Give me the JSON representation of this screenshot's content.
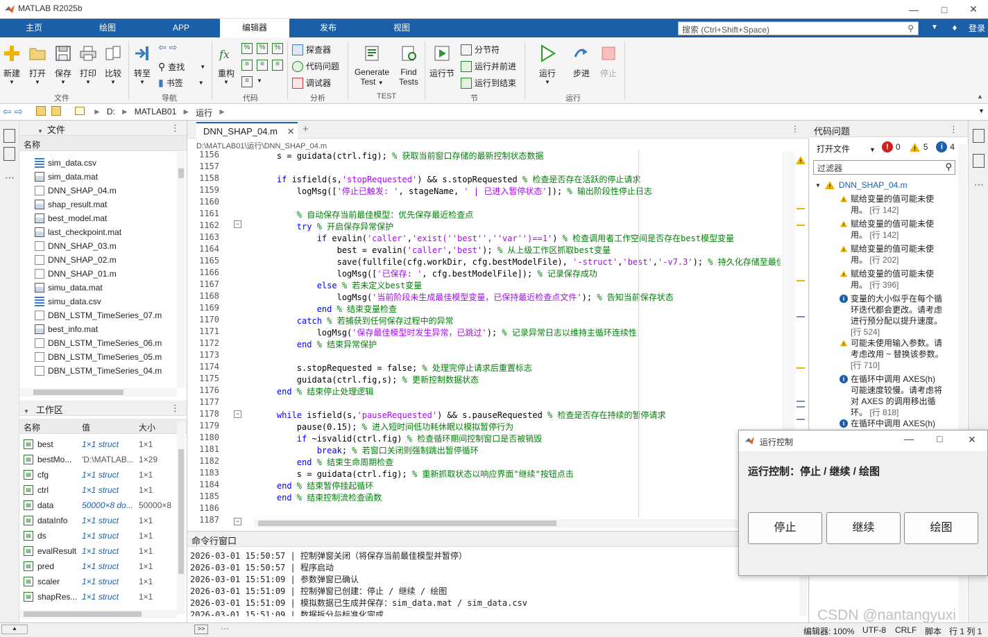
{
  "window": {
    "title": "MATLAB R2025b"
  },
  "tabs": [
    {
      "label": "主页"
    },
    {
      "label": "绘图"
    },
    {
      "label": "APP"
    },
    {
      "label": "编辑器"
    },
    {
      "label": "发布"
    },
    {
      "label": "视图"
    }
  ],
  "search": {
    "placeholder": "搜索 (Ctrl+Shift+Space)"
  },
  "login": "登录",
  "ribbon": {
    "file": {
      "group": "文件",
      "new": "新建",
      "open": "打开",
      "save": "保存",
      "print": "打印",
      "compare": "比较"
    },
    "nav": {
      "group": "导航",
      "goto": "转至",
      "find": "查找",
      "bookmark": "书签"
    },
    "code": {
      "group": "代码",
      "refactor": "重构"
    },
    "analyze": {
      "group": "分析",
      "explorer": "探查器",
      "issues": "代码问题",
      "debugger": "调试器"
    },
    "test": {
      "group": "TEST",
      "gen1": "Generate",
      "gen2": "Test",
      "find1": "Find",
      "find2": "Tests"
    },
    "section": {
      "group": "节",
      "run_section": "运行节",
      "divider": "分节符",
      "run_advance": "运行并前进",
      "run_to_end": "运行到结束"
    },
    "run": {
      "group": "运行",
      "run": "运行",
      "step": "步进",
      "stop": "停止"
    }
  },
  "address": {
    "parts": [
      "D:",
      "MATLAB01",
      "运行"
    ]
  },
  "files": {
    "title": "文件",
    "col_name": "名称",
    "items": [
      "sim_data.csv",
      "sim_data.mat",
      "DNN_SHAP_04.m",
      "shap_result.mat",
      "best_model.mat",
      "last_checkpoint.mat",
      "DNN_SHAP_03.m",
      "DNN_SHAP_02.m",
      "DNN_SHAP_01.m",
      "simu_data.mat",
      "simu_data.csv",
      "DBN_LSTM_TimeSeries_07.m",
      "best_info.mat",
      "DBN_LSTM_TimeSeries_06.m",
      "DBN_LSTM_TimeSeries_05.m",
      "DBN_LSTM_TimeSeries_04.m",
      "DBN_LSTM_TimeSeries_03.m"
    ]
  },
  "workspace": {
    "title": "工作区",
    "cols": {
      "name": "名称",
      "value": "值",
      "size": "大小"
    },
    "rows": [
      {
        "name": "best",
        "value": "1×1 struct",
        "size": "1×1"
      },
      {
        "name": "bestMo...",
        "value": "'D:\\MATLAB...",
        "size": "1×29"
      },
      {
        "name": "cfg",
        "value": "1×1 struct",
        "size": "1×1"
      },
      {
        "name": "ctrl",
        "value": "1×1 struct",
        "size": "1×1"
      },
      {
        "name": "data",
        "value": "50000×8 do...",
        "size": "50000×8"
      },
      {
        "name": "dataInfo",
        "value": "1×1 struct",
        "size": "1×1"
      },
      {
        "name": "ds",
        "value": "1×1 struct",
        "size": "1×1"
      },
      {
        "name": "evalResult",
        "value": "1×1 struct",
        "size": "1×1"
      },
      {
        "name": "pred",
        "value": "1×1 struct",
        "size": "1×1"
      },
      {
        "name": "scaler",
        "value": "1×1 struct",
        "size": "1×1"
      },
      {
        "name": "shapRes...",
        "value": "1×1 struct",
        "size": "1×1"
      }
    ]
  },
  "editor": {
    "tab": "DNN_SHAP_04.m",
    "path": "D:\\MATLAB01\\运行\\DNN_SHAP_04.m",
    "lines": [
      {
        "n": "1156",
        "segs": [
          [
            "",
            "    s = guidata(ctrl.fig); "
          ],
          [
            "cm",
            "% 获取当前窗口存储的最新控制状态数据"
          ]
        ]
      },
      {
        "n": "1157",
        "segs": []
      },
      {
        "n": "1158",
        "segs": [
          [
            "kw",
            "    if "
          ],
          [
            "",
            "isfield(s,"
          ],
          [
            "str",
            "'stopRequested'"
          ],
          [
            "",
            ") && s.stopRequested "
          ],
          [
            "cm",
            "% 检查是否存在活跃的停止请求"
          ]
        ]
      },
      {
        "n": "1159",
        "segs": [
          [
            "",
            "        logMsg(["
          ],
          [
            "str",
            "'停止已触发: '"
          ],
          [
            "",
            ", stageName, "
          ],
          [
            "str",
            "' | 已进入暂停状态'"
          ],
          [
            "",
            "]); "
          ],
          [
            "cm",
            "% 输出阶段性停止日志"
          ]
        ]
      },
      {
        "n": "1160",
        "segs": []
      },
      {
        "n": "1161",
        "segs": [
          [
            "cm",
            "        % 自动保存当前最佳模型：优先保存最近检查点"
          ]
        ]
      },
      {
        "n": "1162",
        "segs": [
          [
            "kw",
            "        try "
          ],
          [
            "cm",
            "% 开启保存异常保护"
          ]
        ]
      },
      {
        "n": "1163",
        "segs": [
          [
            "kw",
            "            if "
          ],
          [
            "",
            "evalin("
          ],
          [
            "str",
            "'caller'"
          ],
          [
            "",
            ","
          ],
          [
            "str",
            "'exist(''best'',''var'')==1'"
          ],
          [
            "",
            ") "
          ],
          [
            "cm",
            "% 检查调用者工作空间是否存在best模型变量"
          ]
        ]
      },
      {
        "n": "1164",
        "segs": [
          [
            "",
            "                best = evalin("
          ],
          [
            "str",
            "'caller'"
          ],
          [
            "",
            ","
          ],
          [
            "str",
            "'best'"
          ],
          [
            "",
            "); "
          ],
          [
            "cm",
            "% 从上级工作区抓取best变量"
          ]
        ]
      },
      {
        "n": "1165",
        "segs": [
          [
            "",
            "                save(fullfile(cfg.workDir, cfg.bestModelFile), "
          ],
          [
            "str",
            "'-struct'"
          ],
          [
            "",
            ","
          ],
          [
            "str",
            "'best'"
          ],
          [
            "",
            ","
          ],
          [
            "str",
            "'-v7.3'"
          ],
          [
            "",
            "); "
          ],
          [
            "cm",
            "% 持久化存储至最佳"
          ]
        ]
      },
      {
        "n": "1166",
        "segs": [
          [
            "",
            "                logMsg(["
          ],
          [
            "str",
            "'已保存: '"
          ],
          [
            "",
            ", cfg.bestModelFile]); "
          ],
          [
            "cm",
            "% 记录保存成功"
          ]
        ]
      },
      {
        "n": "1167",
        "segs": [
          [
            "kw",
            "            else "
          ],
          [
            "cm",
            "% 若未定义best变量"
          ]
        ]
      },
      {
        "n": "1168",
        "segs": [
          [
            "",
            "                logMsg("
          ],
          [
            "str",
            "'当前阶段未生成最佳模型变量，已保持最近检查点文件'"
          ],
          [
            "",
            "); "
          ],
          [
            "cm",
            "% 告知当前保存状态"
          ]
        ]
      },
      {
        "n": "1169",
        "segs": [
          [
            "kw",
            "            end "
          ],
          [
            "cm",
            "% 结束变量检查"
          ]
        ]
      },
      {
        "n": "1170",
        "segs": [
          [
            "kw",
            "        catch "
          ],
          [
            "cm",
            "% 若捕获到任何保存过程中的异常"
          ]
        ]
      },
      {
        "n": "1171",
        "segs": [
          [
            "",
            "            logMsg("
          ],
          [
            "str",
            "'保存最佳模型时发生异常，已跳过'"
          ],
          [
            "",
            "); "
          ],
          [
            "cm",
            "% 记录异常日志以维持主循环连续性"
          ]
        ]
      },
      {
        "n": "1172",
        "segs": [
          [
            "kw",
            "        end "
          ],
          [
            "cm",
            "% 结束异常保护"
          ]
        ]
      },
      {
        "n": "1173",
        "segs": []
      },
      {
        "n": "1174",
        "segs": [
          [
            "",
            "        s.stopRequested = false; "
          ],
          [
            "cm",
            "% 处理完停止请求后重置标志"
          ]
        ]
      },
      {
        "n": "1175",
        "segs": [
          [
            "",
            "        guidata(ctrl.fig,s); "
          ],
          [
            "cm",
            "% 更新控制数据状态"
          ]
        ]
      },
      {
        "n": "1176",
        "segs": [
          [
            "kw",
            "    end "
          ],
          [
            "cm",
            "% 结束停止处理逻辑"
          ]
        ]
      },
      {
        "n": "1177",
        "segs": []
      },
      {
        "n": "1178",
        "segs": [
          [
            "kw",
            "    while "
          ],
          [
            "",
            "isfield(s,"
          ],
          [
            "str",
            "'pauseRequested'"
          ],
          [
            "",
            ") && s.pauseRequested "
          ],
          [
            "cm",
            "% 检查是否存在持续的暂停请求"
          ]
        ]
      },
      {
        "n": "1179",
        "segs": [
          [
            "",
            "        pause(0.15); "
          ],
          [
            "cm",
            "% 进入短时间低功耗休眠以模拟暂停行为"
          ]
        ]
      },
      {
        "n": "1180",
        "segs": [
          [
            "kw",
            "        if "
          ],
          [
            "",
            "~isvalid(ctrl.fig) "
          ],
          [
            "cm",
            "% 检查循环期间控制窗口是否被销毁"
          ]
        ]
      },
      {
        "n": "1181",
        "segs": [
          [
            "kw",
            "            break"
          ],
          [
            "",
            "; "
          ],
          [
            "cm",
            "% 若窗口关闭则强制跳出暂停循环"
          ]
        ]
      },
      {
        "n": "1182",
        "segs": [
          [
            "kw",
            "        end "
          ],
          [
            "cm",
            "% 结束生命周期检查"
          ]
        ]
      },
      {
        "n": "1183",
        "segs": [
          [
            "",
            "        s = guidata(ctrl.fig); "
          ],
          [
            "cm",
            "% 重新抓取状态以响应界面\"继续\"按钮点击"
          ]
        ]
      },
      {
        "n": "1184",
        "segs": [
          [
            "kw",
            "    end "
          ],
          [
            "cm",
            "% 结束暂停挂起循环"
          ]
        ]
      },
      {
        "n": "1185",
        "segs": [
          [
            "kw",
            "    end "
          ],
          [
            "cm",
            "% 结束控制流检查函数"
          ]
        ]
      },
      {
        "n": "1186",
        "segs": []
      },
      {
        "n": "1187",
        "segs": []
      }
    ]
  },
  "command": {
    "title": "命令行窗口",
    "lines": [
      "2026-03-01 15:50:57 | 控制弹窗关闭（将保存当前最佳模型并暂停）",
      "2026-03-01 15:50:57 | 程序启动",
      "2026-03-01 15:51:09 | 参数弹窗已确认",
      "2026-03-01 15:51:09 | 控制弹窗已创建：停止 / 继续 / 绘图",
      "2026-03-01 15:51:09 | 模拟数据已生成并保存：sim_data.mat / sim_data.csv",
      "2026-03-01 15:51:09 | 数据拆分与标准化完成"
    ]
  },
  "issues": {
    "title": "代码问题",
    "open_files": "打开文件",
    "counts": {
      "errors": "0",
      "warnings": "5",
      "info": "4"
    },
    "filter": "过滤器",
    "file": "DNN_SHAP_04.m",
    "items": [
      {
        "type": "warn",
        "text": "赋给变量的值可能未使用。",
        "ref": "[行 142]"
      },
      {
        "type": "warn",
        "text": "赋给变量的值可能未使用。",
        "ref": "[行 142]"
      },
      {
        "type": "warn",
        "text": "赋给变量的值可能未使用。",
        "ref": "[行 202]"
      },
      {
        "type": "warn",
        "text": "赋给变量的值可能未使用。",
        "ref": "[行 396]"
      },
      {
        "type": "info",
        "text": "变量的大小似乎在每个循环迭代都会更改。请考虑进行预分配以提升速度。",
        "ref": "[行 524]"
      },
      {
        "type": "warn",
        "text": "可能未使用输入参数。请考虑改用 ~ 替换该参数。",
        "ref": "[行 710]"
      },
      {
        "type": "info",
        "text": "在循环中调用 AXES(h) 可能速度较慢。请考虑将对 AXES 的调用移出循环。",
        "ref": "[行 818]"
      },
      {
        "type": "info",
        "text": "在循环中调用 AXES(h)",
        "ref": ""
      }
    ]
  },
  "dialog": {
    "title": "运行控制",
    "heading": "运行控制：停止 / 继续 / 绘图",
    "buttons": [
      "停止",
      "继续",
      "绘图"
    ]
  },
  "status": {
    "zoom": "编辑器: 100%",
    "encoding": "UTF-8",
    "eol": "CRLF",
    "type": "脚本",
    "pos": "行 1 列 1"
  },
  "watermark": "CSDN @nantangyuxi"
}
